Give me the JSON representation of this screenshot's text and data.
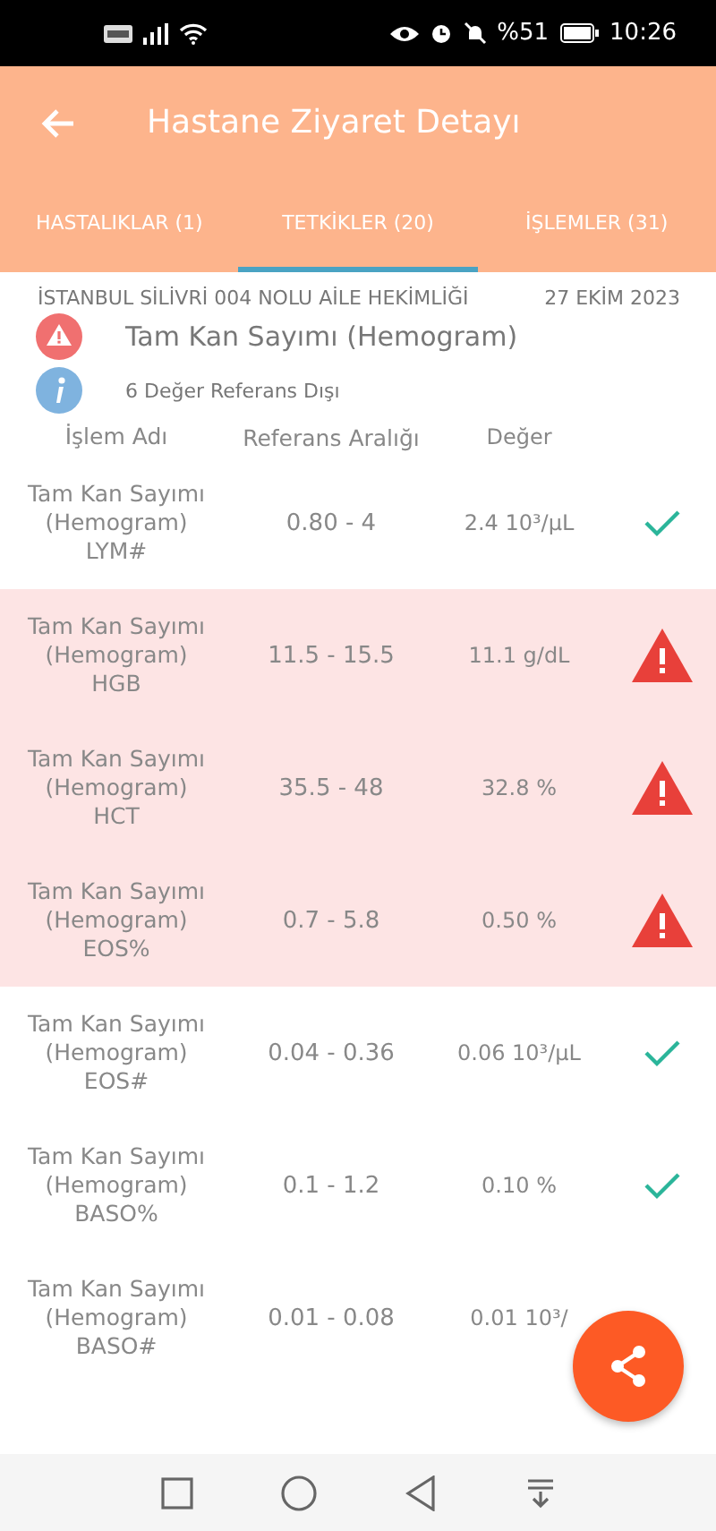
{
  "status_bar": {
    "battery_text": "%51",
    "time": "10:26"
  },
  "header": {
    "title": "Hastane Ziyaret Detayı"
  },
  "tabs": [
    {
      "label": "HASTALIKLAR (1)",
      "selected": false
    },
    {
      "label": "TETKİKLER (20)",
      "selected": true
    },
    {
      "label": "İŞLEMLER (31)",
      "selected": false
    }
  ],
  "visit": {
    "facility": "İSTANBUL SİLİVRİ 004 NOLU AİLE HEKİMLİĞİ",
    "date": "27 EKİM 2023",
    "test_name": "Tam Kan Sayımı (Hemogram)",
    "summary": "6 Değer Referans Dışı"
  },
  "table": {
    "columns": [
      "İşlem Adı",
      "Referans Aralığı",
      "Değer"
    ],
    "rows": [
      {
        "name": "Tam Kan Sayımı (Hemogram) LYM#",
        "range": "0.80 - 4",
        "value": "2.4 10³/µL",
        "kind": "normal"
      },
      {
        "name": "Tam Kan Sayımı (Hemogram) HGB",
        "range": "11.5 - 15.5",
        "value": "11.1 g/dL",
        "kind": "abnormal"
      },
      {
        "name": "Tam Kan Sayımı (Hemogram) HCT",
        "range": "35.5 - 48",
        "value": "32.8 %",
        "kind": "abnormal"
      },
      {
        "name": "Tam Kan Sayımı (Hemogram) EOS%",
        "range": "0.7 - 5.8",
        "value": "0.50 %",
        "kind": "abnormal"
      },
      {
        "name": "Tam Kan Sayımı (Hemogram) EOS#",
        "range": "0.04 - 0.36",
        "value": "0.06 10³/µL",
        "kind": "normal"
      },
      {
        "name": "Tam Kan Sayımı (Hemogram) BASO%",
        "range": "0.1 - 1.2",
        "value": "0.10 %",
        "kind": "normal"
      },
      {
        "name": "Tam Kan Sayımı (Hemogram) BASO#",
        "range": "0.01 - 0.08",
        "value": "0.01 10³/",
        "kind": "none"
      }
    ]
  }
}
